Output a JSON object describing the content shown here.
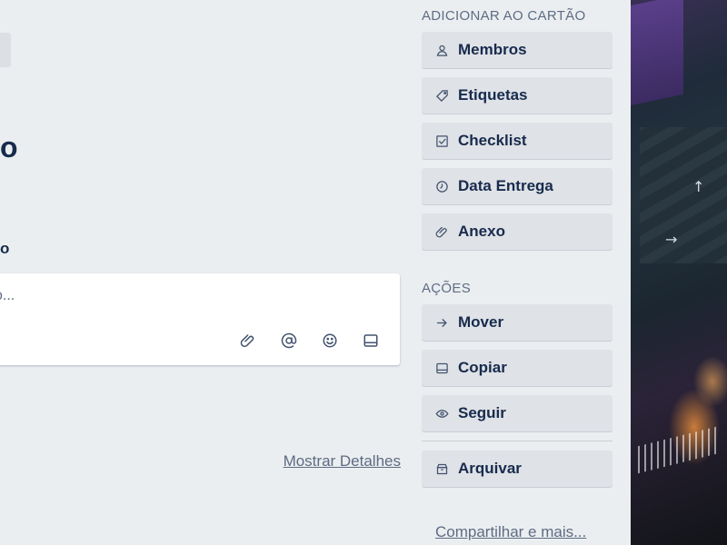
{
  "card": {
    "title_fragment": "o",
    "section_fragment": "o",
    "comment": {
      "placeholder": "o..."
    },
    "details_link": "Mostrar Detalhes"
  },
  "sidebar": {
    "add_title": "ADICIONAR AO CARTÃO",
    "add_items": [
      {
        "label": "Membros",
        "icon": "person-icon"
      },
      {
        "label": "Etiquetas",
        "icon": "tag-icon"
      },
      {
        "label": "Checklist",
        "icon": "checkbox-icon"
      },
      {
        "label": "Data Entrega",
        "icon": "clock-icon"
      },
      {
        "label": "Anexo",
        "icon": "paperclip-icon"
      }
    ],
    "actions_title": "AÇÕES",
    "action_items": [
      {
        "label": "Mover",
        "icon": "arrow-right-icon"
      },
      {
        "label": "Copiar",
        "icon": "card-icon"
      },
      {
        "label": "Seguir",
        "icon": "eye-icon"
      },
      {
        "label": "Arquivar",
        "icon": "archive-icon"
      }
    ],
    "share_link": "Compartilhar e mais..."
  },
  "colors": {
    "panel_bg": "#ebeef0",
    "button_bg": "#dfe2e6",
    "text_dark": "#172b4d",
    "text_muted": "#5e6c84"
  }
}
